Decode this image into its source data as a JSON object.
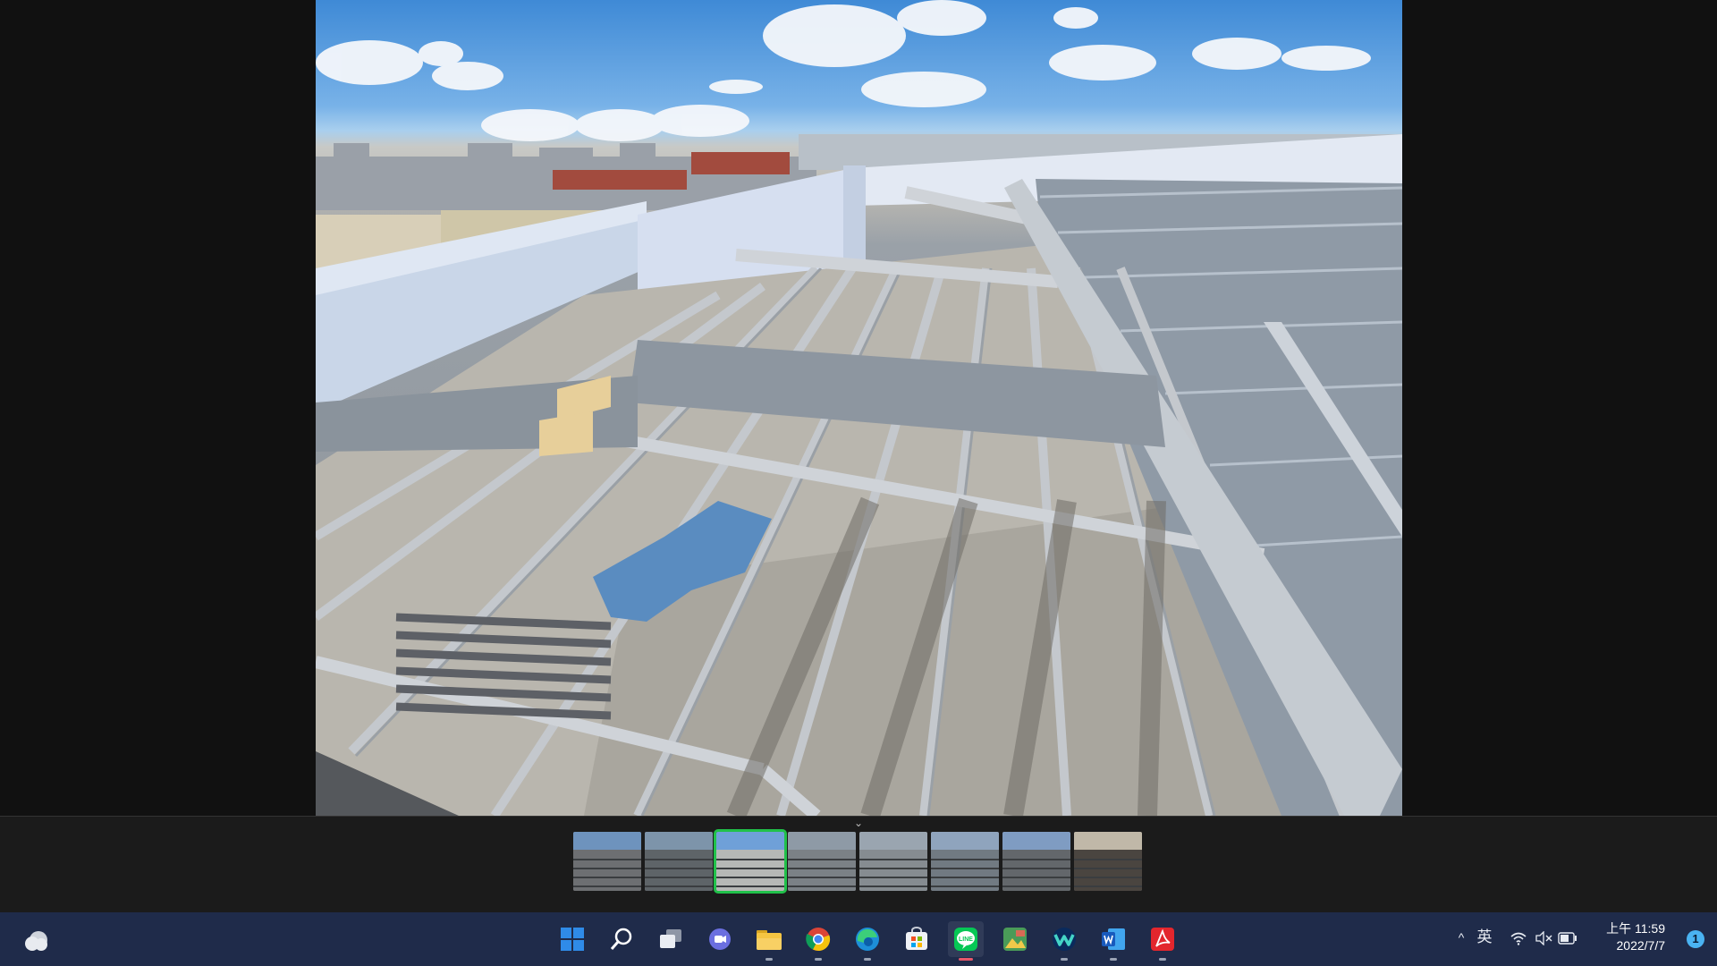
{
  "viewer": {
    "photo_name": "rooftop-steel-frame-photo"
  },
  "filmstrip": {
    "collapse_glyph": "⌄",
    "selected_index": 2,
    "thumbnails": [
      {
        "name": "photo-1"
      },
      {
        "name": "photo-2"
      },
      {
        "name": "photo-3"
      },
      {
        "name": "photo-4"
      },
      {
        "name": "photo-5"
      },
      {
        "name": "photo-6"
      },
      {
        "name": "photo-7"
      },
      {
        "name": "photo-8"
      }
    ]
  },
  "taskbar": {
    "apps": [
      {
        "icon": "windows-start-icon",
        "running": false
      },
      {
        "icon": "search-icon",
        "running": false
      },
      {
        "icon": "task-view-icon",
        "running": false
      },
      {
        "icon": "chat-icon",
        "running": false
      },
      {
        "icon": "file-explorer-icon",
        "running": true
      },
      {
        "icon": "chrome-icon",
        "running": true
      },
      {
        "icon": "edge-icon",
        "running": true
      },
      {
        "icon": "store-icon",
        "running": false
      },
      {
        "icon": "line-icon",
        "running": true,
        "active": true
      },
      {
        "icon": "photos-app-icon",
        "running": false
      },
      {
        "icon": "webex-icon",
        "running": true
      },
      {
        "icon": "word-icon",
        "running": true
      },
      {
        "icon": "acrobat-icon",
        "running": true
      }
    ],
    "tray": {
      "chevron": "^",
      "ime": "英",
      "time": "上午 11:59",
      "date": "2022/7/7",
      "notification_count": "1"
    }
  },
  "colors": {
    "selected_outline": "#21c14a",
    "taskbar_bg": "#1f2b4a",
    "viewer_bg": "#111111"
  }
}
